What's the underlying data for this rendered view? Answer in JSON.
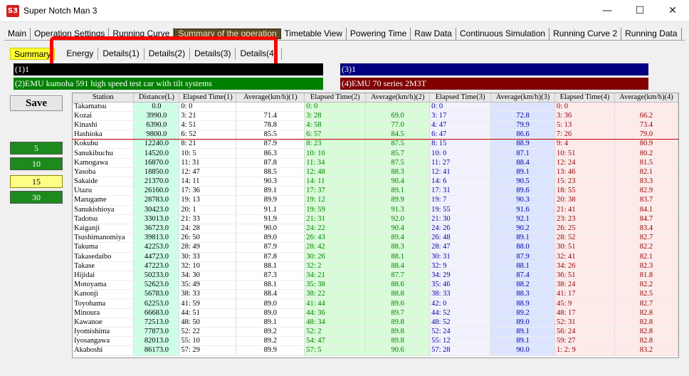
{
  "window": {
    "icon_text": "S3",
    "title": "Super Notch Man 3",
    "minimize": "—",
    "maximize": "☐",
    "close": "✕"
  },
  "main_tabs": [
    "Main",
    "Operation Settings",
    "Running Curve",
    "Summary of the operation",
    "Timetable View",
    "Powering Time",
    "Raw Data",
    "Continuous Simulation",
    "Running Curve 2",
    "Running Data"
  ],
  "sub_tabs": {
    "summary": "Summary",
    "items": [
      "Energy",
      "Details(1)",
      "Details(2)",
      "Details(3)",
      "Details(4)"
    ]
  },
  "series": [
    {
      "label": "(1)1",
      "color": "#000000"
    },
    {
      "label": "(2)EMU kumoha 591 high speed test car with tilt systems",
      "color": "#008000"
    },
    {
      "label": "(3)1",
      "color": "#000080"
    },
    {
      "label": "(4)EMU 70 series  2M3T",
      "color": "#800000"
    }
  ],
  "save_label": "Save",
  "intervals": [
    {
      "label": "5",
      "active": false
    },
    {
      "label": "10",
      "active": false
    },
    {
      "label": "15",
      "active": true
    },
    {
      "label": "30",
      "active": false
    }
  ],
  "columns": [
    "Station",
    "Distance(L)",
    "Elapsed Time(1)",
    "Average(km/h)(1)",
    "Elapsed Time(2)",
    "Average(km/h)(2)",
    "Elapsed Time(3)",
    "Average(km/h)(3)",
    "Elapsed Time(4)",
    "Average(km/h)(4)"
  ],
  "rows": [
    [
      "Takamatsu",
      "0.0",
      "0: 0",
      "",
      "0: 0",
      "",
      "0: 0",
      "",
      "0: 0",
      ""
    ],
    [
      "Kozai",
      "3990.0",
      "3: 21",
      "71.4",
      "3: 28",
      "69.0",
      "3: 17",
      "72.8",
      "3: 36",
      "66.2"
    ],
    [
      "Kinashi",
      "6390.0",
      "4: 51",
      "78.8",
      "4: 58",
      "77.0",
      "4: 47",
      "79.9",
      "5: 13",
      "73.4"
    ],
    [
      "Hashioka",
      "9800.0",
      "6: 52",
      "85.5",
      "6: 57",
      "84.5",
      "6: 47",
      "86.6",
      "7: 26",
      "79.0"
    ],
    [
      "Kokubu",
      "12240.0",
      "8: 21",
      "87.9",
      "8: 23",
      "87.5",
      "8: 15",
      "88.9",
      "9: 4",
      "80.9"
    ],
    [
      "Sanukibuchu",
      "14520.0",
      "10: 5",
      "86.3",
      "10: 10",
      "85.7",
      "10: 0",
      "87.1",
      "10: 51",
      "80.2"
    ],
    [
      "Kamogawa",
      "16870.0",
      "11: 31",
      "87.8",
      "11: 34",
      "87.5",
      "11: 27",
      "88.4",
      "12: 24",
      "81.5"
    ],
    [
      "Yasoba",
      "18850.0",
      "12: 47",
      "88.5",
      "12: 48",
      "88.3",
      "12: 41",
      "89.1",
      "13: 46",
      "82.1"
    ],
    [
      "Sakaide",
      "21370.0",
      "14: 11",
      "90.3",
      "14: 11",
      "90.4",
      "14: 6",
      "90.5",
      "15: 23",
      "83.3"
    ],
    [
      "Utazu",
      "26160.0",
      "17: 36",
      "89.1",
      "17: 37",
      "89.1",
      "17: 31",
      "89.6",
      "18: 55",
      "82.9"
    ],
    [
      "Marugame",
      "28783.0",
      "19: 13",
      "89.9",
      "19: 12",
      "89.9",
      "19: 7",
      "90.3",
      "20: 38",
      "83.7"
    ],
    [
      "Sanukishioya",
      "30423.0",
      "20: 1",
      "91.1",
      "19: 59",
      "91.3",
      "19: 55",
      "91.6",
      "21: 41",
      "84.1"
    ],
    [
      "Tadotsu",
      "33013.0",
      "21: 33",
      "91.9",
      "21: 31",
      "92.0",
      "21: 30",
      "92.1",
      "23: 23",
      "84.7"
    ],
    [
      "Kaiganji",
      "36723.0",
      "24: 28",
      "90.0",
      "24: 22",
      "90.4",
      "24: 26",
      "90.2",
      "26: 25",
      "83.4"
    ],
    [
      "Tsushimanomiya",
      "39813.0",
      "26: 50",
      "89.0",
      "26: 43",
      "89.4",
      "26: 48",
      "89.1",
      "28: 52",
      "82.7"
    ],
    [
      "Takuma",
      "42253.0",
      "28: 49",
      "87.9",
      "28: 42",
      "88.3",
      "28: 47",
      "88.0",
      "30: 51",
      "82.2"
    ],
    [
      "Takasedaibo",
      "44723.0",
      "30: 33",
      "87.8",
      "30: 26",
      "88.1",
      "30: 31",
      "87.9",
      "32: 41",
      "82.1"
    ],
    [
      "Takase",
      "47223.0",
      "32: 10",
      "88.1",
      "32: 2",
      "88.4",
      "32: 9",
      "88.1",
      "34: 26",
      "82.3"
    ],
    [
      "Hijidai",
      "50233.0",
      "34: 30",
      "87.3",
      "34: 21",
      "87.7",
      "34: 29",
      "87.4",
      "36: 51",
      "81.8"
    ],
    [
      "Motoyama",
      "52623.0",
      "35: 49",
      "88.1",
      "35: 38",
      "88.6",
      "35: 46",
      "88.2",
      "38: 24",
      "82.2"
    ],
    [
      "Kanonji",
      "56783.0",
      "38: 33",
      "88.4",
      "38: 22",
      "88.8",
      "38: 33",
      "88.3",
      "41: 17",
      "82.5"
    ],
    [
      "Toyohama",
      "62253.0",
      "41: 59",
      "89.0",
      "41: 44",
      "89.6",
      "42: 0",
      "88.9",
      "45: 9",
      "82.7"
    ],
    [
      "Minoura",
      "66683.0",
      "44: 51",
      "89.0",
      "44: 36",
      "89.7",
      "44: 52",
      "89.2",
      "48: 17",
      "82.8"
    ],
    [
      "Kawanoe",
      "72513.0",
      "48: 50",
      "89.1",
      "48: 34",
      "89.8",
      "48: 52",
      "89.0",
      "52: 31",
      "82.8"
    ],
    [
      "Iyomishima",
      "77873.0",
      "52: 22",
      "89.2",
      "52: 2",
      "89.8",
      "52: 24",
      "89.1",
      "56: 24",
      "82.8"
    ],
    [
      "Iyosangawa",
      "82013.0",
      "55: 10",
      "89.2",
      "54: 47",
      "89.8",
      "55: 12",
      "89.1",
      "59: 27",
      "82.8"
    ],
    [
      "Akaboshi",
      "86173.0",
      "57: 29",
      "89.9",
      "57: 5",
      "90.6",
      "57: 28",
      "90.0",
      "1: 2: 9",
      "83.2"
    ]
  ]
}
